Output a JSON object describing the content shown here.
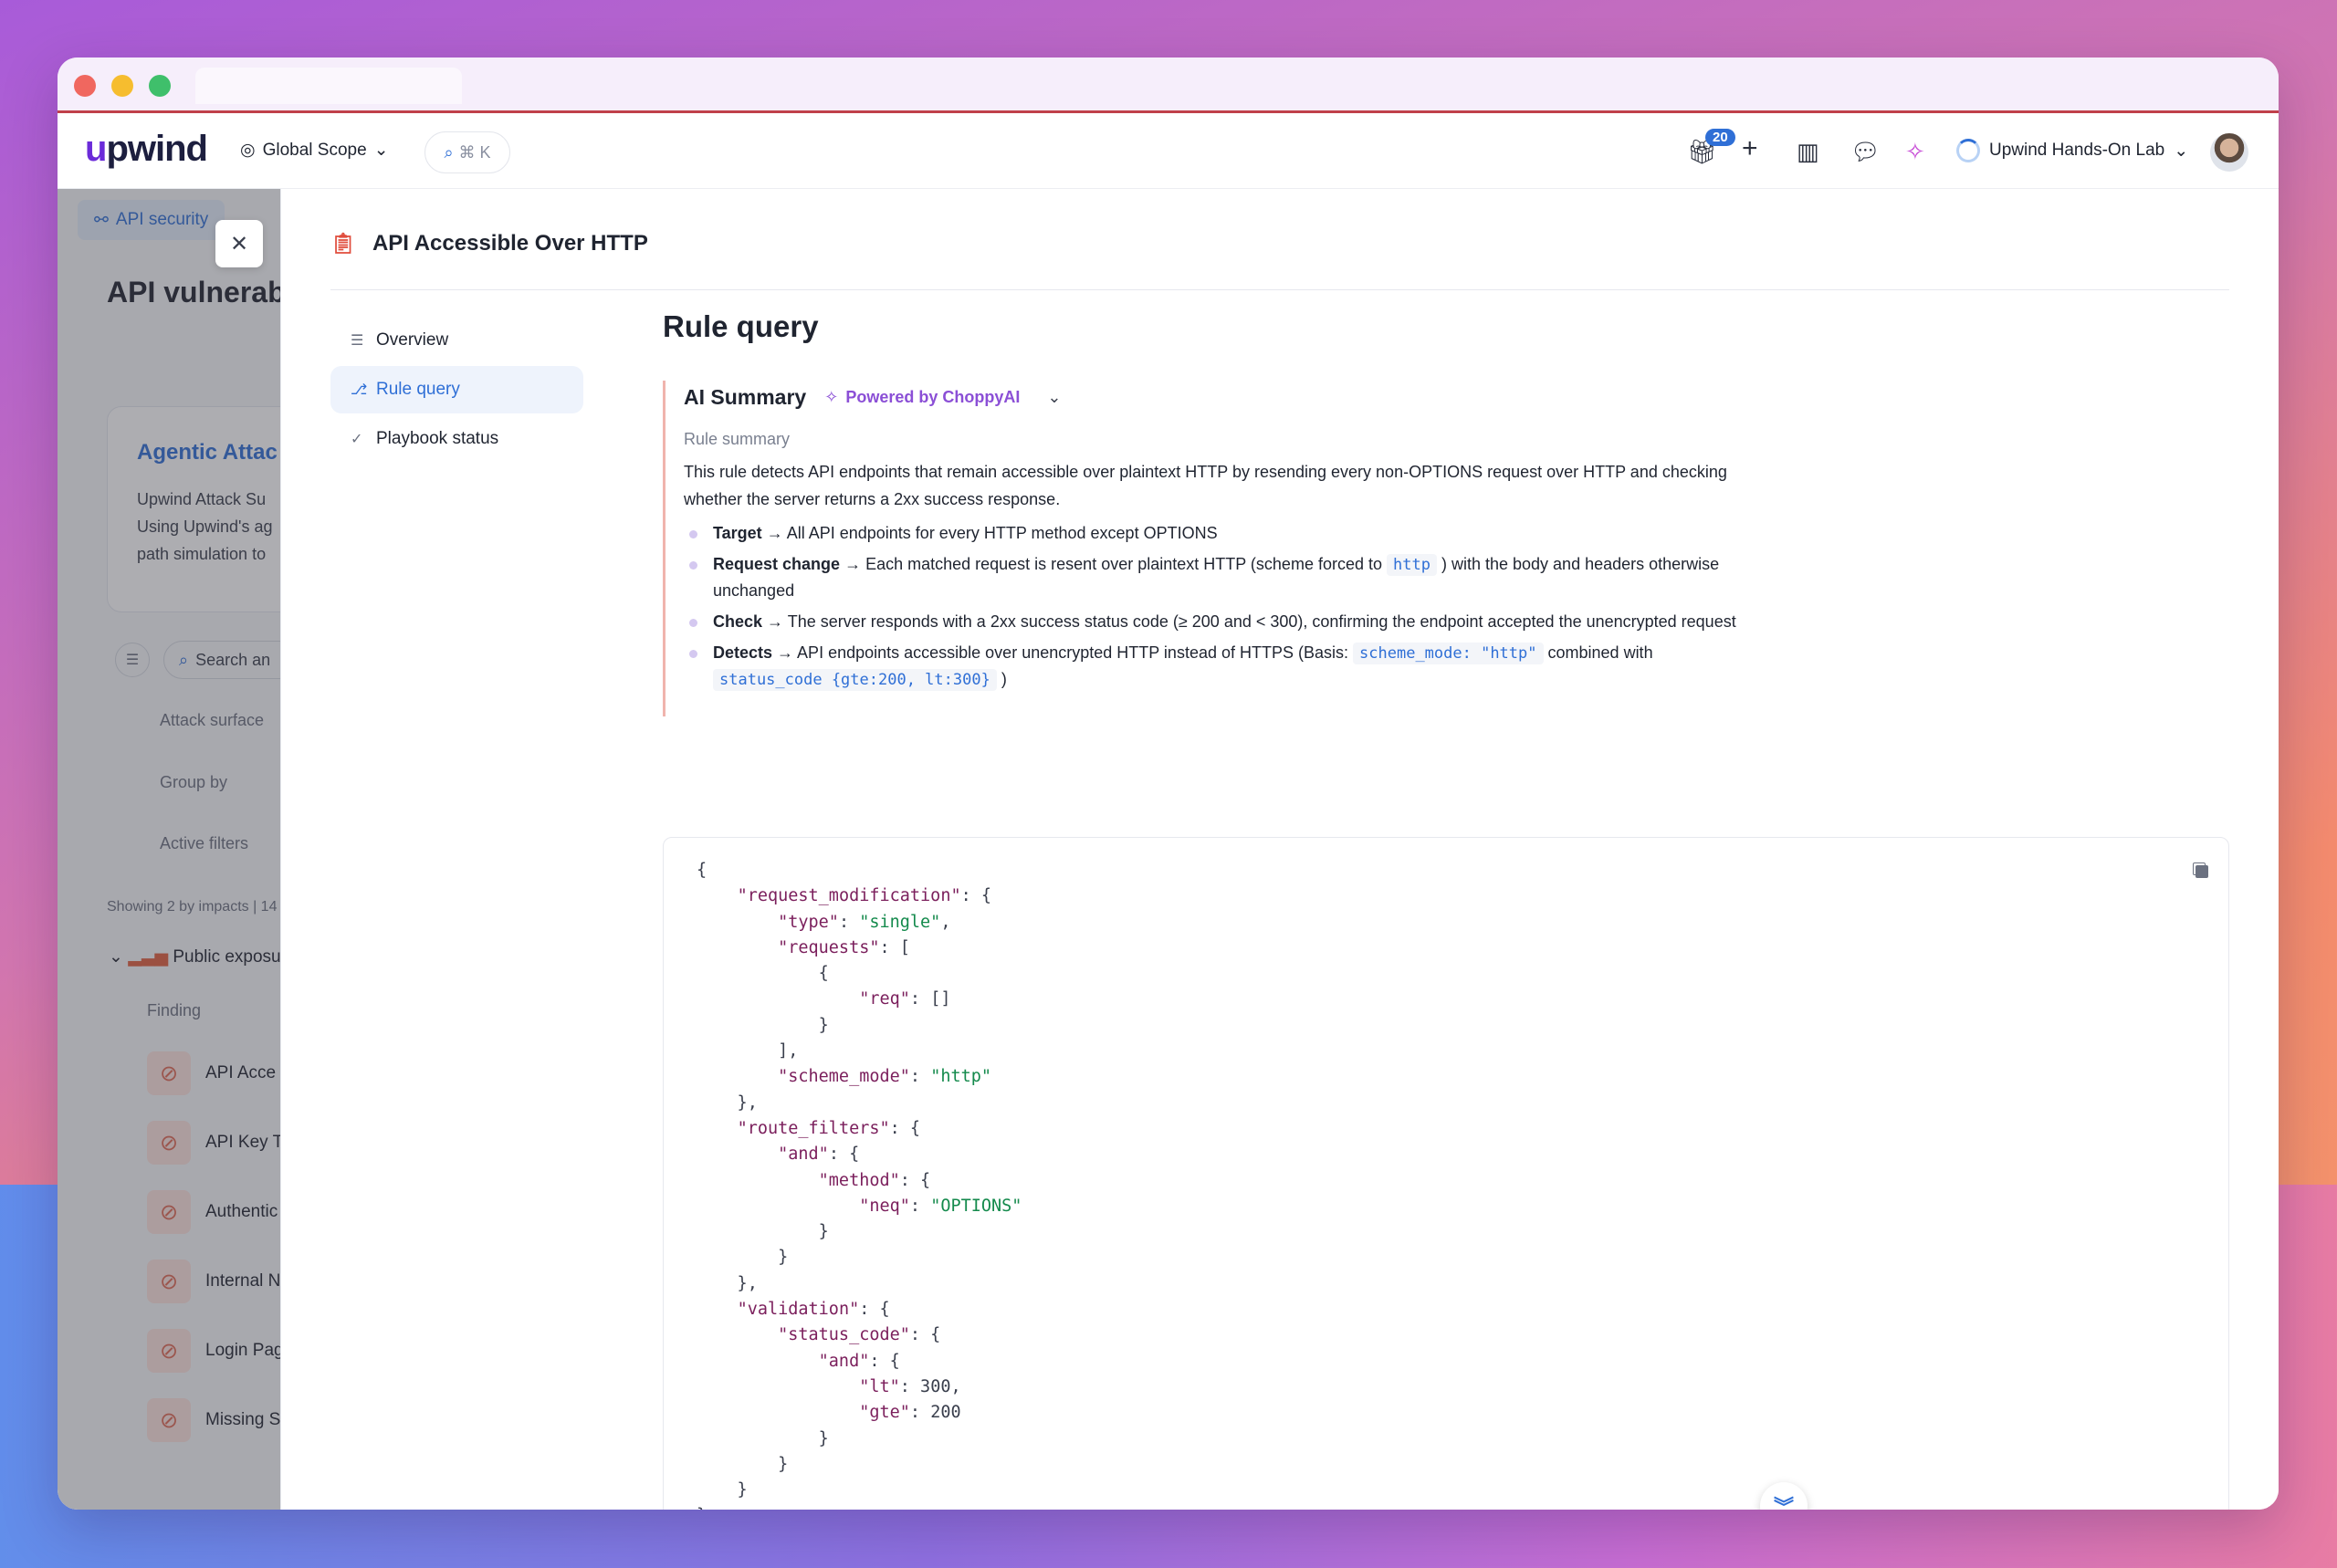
{
  "app": {
    "logo_text": "upwind",
    "scope": "Global Scope",
    "search_shortcut": "⌘ K",
    "gift_count": "20",
    "org": "Upwind Hands-On Lab"
  },
  "background": {
    "tab": "API security",
    "title": "API vulnerab",
    "card_title": "Agentic Attac",
    "card_lines": [
      "Upwind Attack Su",
      "Using Upwind's ag",
      "path simulation to"
    ],
    "search_placeholder": "Search an",
    "rows": [
      "Attack surface",
      "Group by",
      "Active filters"
    ],
    "showing": "Showing 2 by impacts | 14",
    "group": "Public exposur",
    "finding_header": "Finding",
    "findings": [
      "API Acce",
      "API Key T",
      "Authentic",
      "Internal N",
      "Login Pag",
      "Missing S"
    ]
  },
  "panel": {
    "title": "API Accessible Over HTTP",
    "nav": [
      "Overview",
      "Rule query",
      "Playbook status"
    ],
    "heading": "Rule query",
    "ai": {
      "title": "AI Summary",
      "powered": "Powered by ChoppyAI",
      "label": "Rule summary",
      "text": "This rule detects API endpoints that remain accessible over plaintext HTTP by resending every non-OPTIONS request over HTTP and checking whether the server returns a 2xx success response."
    },
    "bullets": [
      {
        "k": "Target",
        "t": "→ All API endpoints for every HTTP method except OPTIONS"
      },
      {
        "k": "Request change",
        "t1": "→ Each matched request is resent over plaintext HTTP (scheme forced to",
        "c1": "http",
        "t2": ") with the body and headers otherwise unchanged"
      },
      {
        "k": "Check",
        "t": "→ The server responds with a 2xx success status code (≥ 200 and < 300), confirming the endpoint accepted the unencrypted request"
      },
      {
        "k": "Detects",
        "t1": "→ API endpoints accessible over unencrypted HTTP instead of HTTPS (Basis:",
        "c1": "scheme_mode: \"http\"",
        "t2": "combined with",
        "c2": "status_code {gte:200, lt:300}",
        "t3": ")"
      }
    ],
    "code": "{\n    \"request_modification\": {\n        \"type\": \"single\",\n        \"requests\": [\n            {\n                \"req\": []\n            }\n        ],\n        \"scheme_mode\": \"http\"\n    },\n    \"route_filters\": {\n        \"and\": {\n            \"method\": {\n                \"neq\": \"OPTIONS\"\n            }\n        }\n    },\n    \"validation\": {\n        \"status_code\": {\n            \"and\": {\n                \"lt\": 300,\n                \"gte\": 200\n            }\n        }\n    }\n}"
  }
}
